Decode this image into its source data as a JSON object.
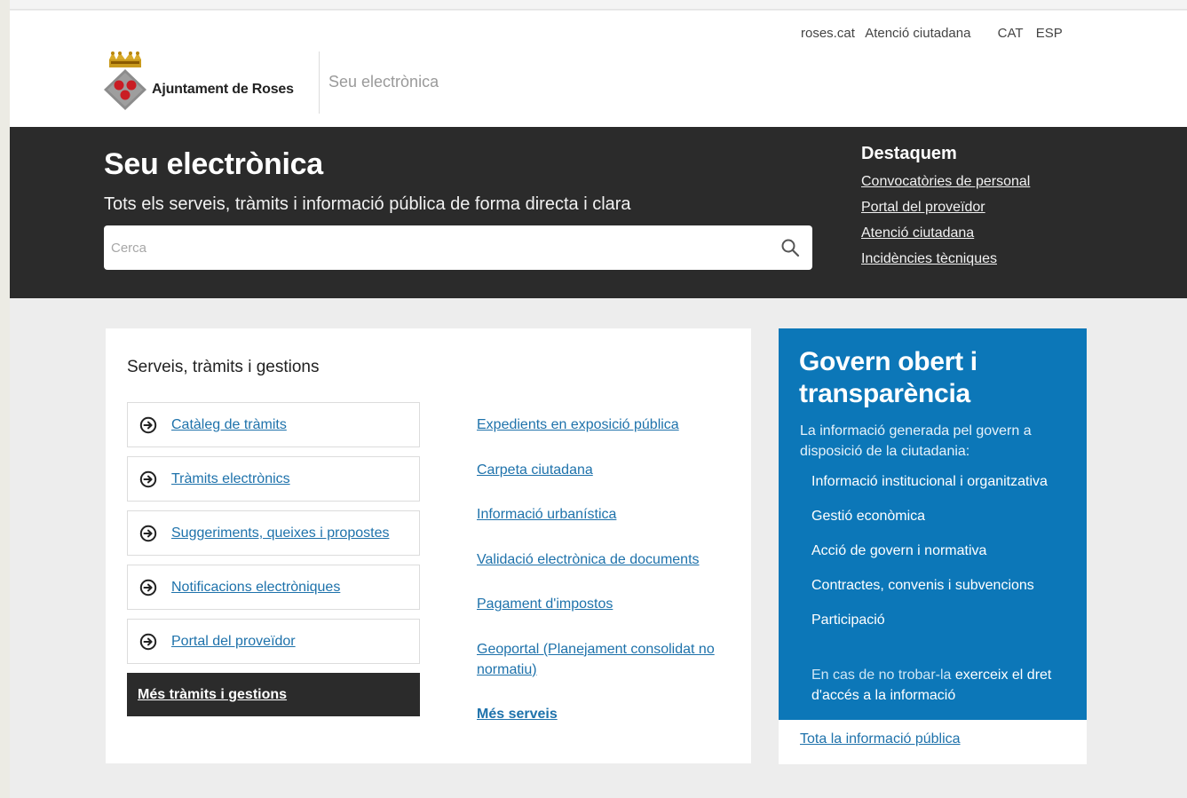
{
  "utility_nav": {
    "links": [
      "roses.cat",
      "Atenció ciutadana"
    ],
    "languages": [
      "CAT",
      "ESP"
    ]
  },
  "header": {
    "org_name": "Ajuntament de Roses",
    "site_subtitle": "Seu electrònica"
  },
  "hero": {
    "title": "Seu electrònica",
    "subtitle": "Tots els serveis, tràmits i informació pública de forma directa i clara",
    "search_placeholder": "Cerca",
    "search_icon": "search-icon"
  },
  "featured": {
    "title": "Destaquem",
    "links": [
      "Convocatòries de personal",
      "Portal del proveïdor",
      "Atenció ciutadana",
      "Incidències tècniques"
    ]
  },
  "services": {
    "title": "Serveis, tràmits i gestions",
    "items": [
      "Catàleg de tràmits",
      "Tràmits electrònics",
      "Suggeriments, queixes i propostes",
      "Notificacions electròniques",
      "Portal del proveïdor"
    ],
    "item_icon": "arrow-circle-right-icon",
    "more_label": "Més tràmits i gestions",
    "links": [
      "Expedients en exposició pública",
      "Carpeta ciutadana",
      "Informació urbanística",
      "Validació electrònica de documents",
      "Pagament d'impostos",
      "Geoportal (Planejament consolidat no normatiu)"
    ],
    "more_services": "Més serveis"
  },
  "govern": {
    "title": "Govern obert i transparència",
    "intro": "La informació generada pel govern a disposició de la ciutadania:",
    "items": [
      "Informació institucional i organitzativa",
      "Gestió econòmica",
      "Acció de govern i normativa",
      "Contractes, convenis i subvencions",
      "Participació"
    ],
    "note_prefix": "En cas de no trobar-la",
    "note_link": "exerceix el dret d'accés a la informació",
    "footer_link": "Tota la informació pública"
  },
  "colors": {
    "hero_bg": "#2b2b2b",
    "accent_blue": "#0c77b8",
    "link_blue": "#1e72ab",
    "page_bg": "#ededed"
  }
}
